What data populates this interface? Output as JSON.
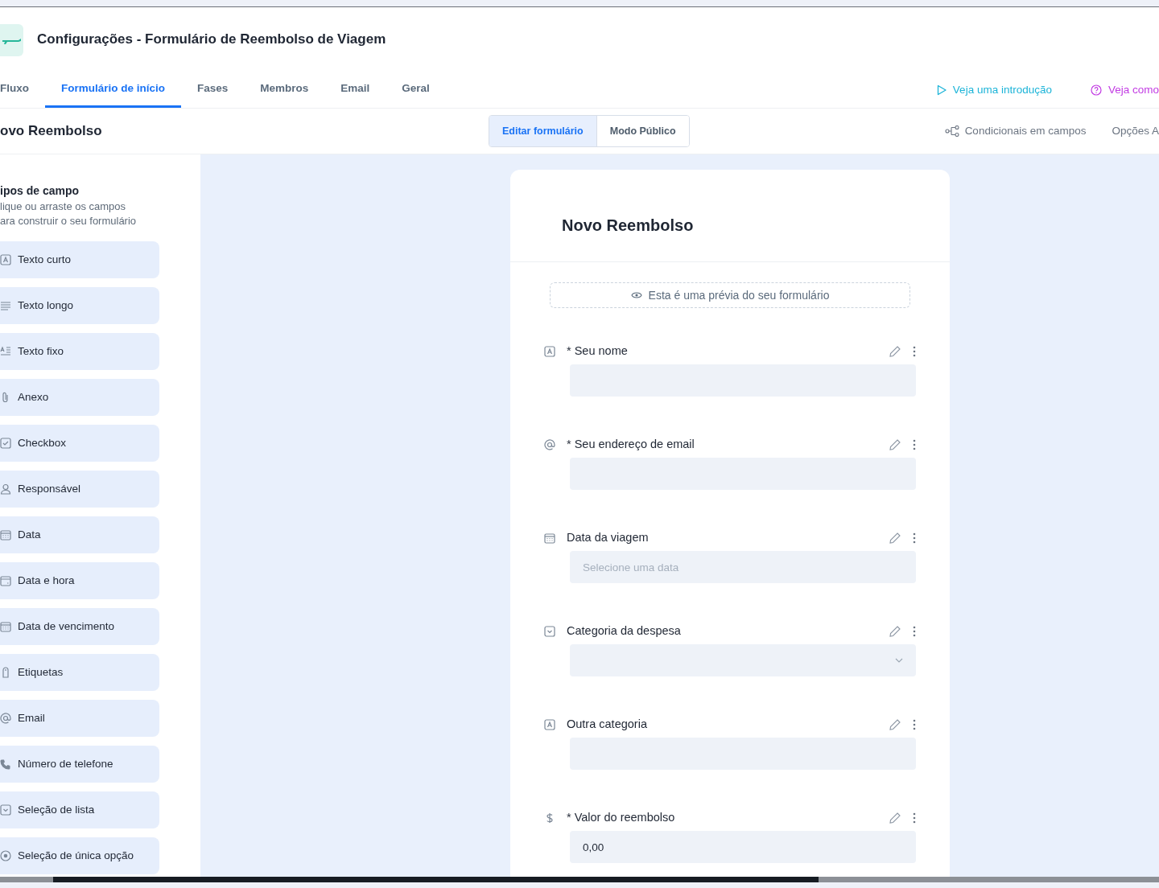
{
  "header": {
    "title": "Configurações - Formulário de Reembolso de Viagem"
  },
  "tabs": [
    {
      "label": "Fluxo",
      "selected": false
    },
    {
      "label": "Formulário de início",
      "selected": true
    },
    {
      "label": "Fases",
      "selected": false
    },
    {
      "label": "Membros",
      "selected": false
    },
    {
      "label": "Email",
      "selected": false
    },
    {
      "label": "Geral",
      "selected": false
    }
  ],
  "help_links": [
    {
      "label": "Veja uma introdução",
      "kind": "video"
    },
    {
      "label": "Veja como",
      "kind": "help"
    }
  ],
  "form_name": "ovo Reembolso",
  "mode_toggle": [
    {
      "label": "Editar formulário",
      "selected": true
    },
    {
      "label": "Modo Público",
      "selected": false
    }
  ],
  "toolbar_links": [
    {
      "label": "Condicionais em campos",
      "kind": "conditions"
    },
    {
      "label": "Opções A",
      "kind": "plain"
    }
  ],
  "sidebar": {
    "title": "ipos de campo",
    "subtitle_lines": [
      "lique ou arraste os campos",
      "ara construir o seu formulário"
    ],
    "items": [
      {
        "label": "Texto curto",
        "kind": "short_text"
      },
      {
        "label": "Texto longo",
        "kind": "long_text"
      },
      {
        "label": "Texto fixo",
        "kind": "fixed_text"
      },
      {
        "label": "Anexo",
        "kind": "attachment"
      },
      {
        "label": "Checkbox",
        "kind": "checkbox"
      },
      {
        "label": "Responsável",
        "kind": "assignee"
      },
      {
        "label": "Data",
        "kind": "date"
      },
      {
        "label": "Data e hora",
        "kind": "datetime"
      },
      {
        "label": "Data de vencimento",
        "kind": "date"
      },
      {
        "label": "Etiquetas",
        "kind": "labels"
      },
      {
        "label": "Email",
        "kind": "email"
      },
      {
        "label": "Número de telefone",
        "kind": "phone"
      },
      {
        "label": "Seleção de lista",
        "kind": "select"
      },
      {
        "label": "Seleção de única opção",
        "kind": "radio"
      }
    ]
  },
  "form": {
    "title": "Novo Reembolso",
    "preview_notice": "Esta é uma prévia do seu formulário",
    "fields": [
      {
        "label": "* Seu nome",
        "kind": "short_text"
      },
      {
        "label": "* Seu endereço de email",
        "kind": "email"
      },
      {
        "label": "Data da viagem",
        "kind": "date",
        "placeholder": "Selecione uma data"
      },
      {
        "label": "Categoria da despesa",
        "kind": "select"
      },
      {
        "label": "Outra categoria",
        "kind": "short_text"
      },
      {
        "label": "* Valor do reembolso",
        "kind": "currency",
        "value": "0,00"
      }
    ]
  }
}
